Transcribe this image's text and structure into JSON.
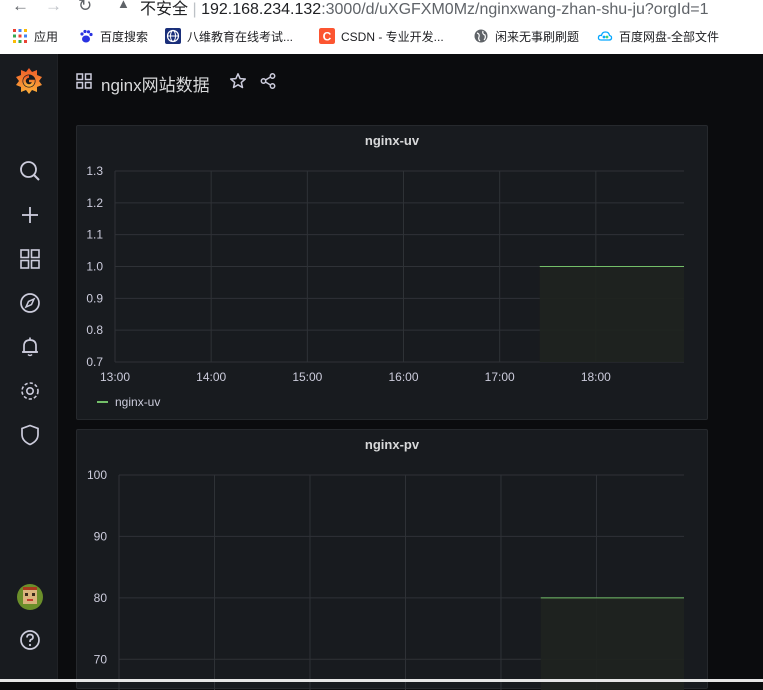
{
  "browser": {
    "security_label": "不安全",
    "url_host": "192.168.234.132",
    "url_path": ":3000/d/uXGFXM0Mz/nginxwang-zhan-shu-ju?orgId=1",
    "bookmarks": [
      {
        "label": "应用",
        "icon": "apps-grid-icon"
      },
      {
        "label": "百度搜索",
        "icon": "baidu-paw-icon"
      },
      {
        "label": "八维教育在线考试...",
        "icon": "bawei-globe-icon"
      },
      {
        "label": "CSDN - 专业开发...",
        "icon": "csdn-c-icon"
      },
      {
        "label": "闲来无事刷刷题",
        "icon": "globe-icon"
      },
      {
        "label": "百度网盘-全部文件",
        "icon": "baidu-cloud-icon"
      }
    ]
  },
  "dashboard": {
    "title": "nginx网站数据"
  },
  "sidebar": {
    "items": [
      "grafana-logo-icon",
      "search-icon",
      "plus-icon",
      "dashboards-grid-icon",
      "explore-compass-icon",
      "alerting-bell-icon",
      "configuration-gear-icon",
      "server-admin-shield-icon",
      "user-avatar",
      "help-icon"
    ]
  },
  "colors": {
    "series": "#73bf69",
    "panel_bg": "#181b1f",
    "page_bg": "#0b0c0e",
    "grid": "#2f3237",
    "fill": "#1f231f"
  },
  "chart_data": [
    {
      "type": "area",
      "title": "nginx-uv",
      "x_ticks": [
        "13:00",
        "14:00",
        "15:00",
        "16:00",
        "17:00",
        "18:00"
      ],
      "y_ticks": [
        "1.3",
        "1.2",
        "1.1",
        "1.0",
        "0.9",
        "0.8",
        "0.7"
      ],
      "ylim": [
        0.7,
        1.3
      ],
      "xlim": [
        "13:00",
        "18:55"
      ],
      "series": [
        {
          "name": "nginx-uv",
          "x": [
            "17:25",
            "18:55"
          ],
          "values": [
            1.0,
            1.0
          ]
        }
      ],
      "legend": "bottom-left",
      "grid": true
    },
    {
      "type": "area",
      "title": "nginx-pv",
      "y_ticks": [
        "100",
        "90",
        "80",
        "70"
      ],
      "ylim": [
        65,
        100
      ],
      "xlim": [
        "13:00",
        "18:55"
      ],
      "series": [
        {
          "x": [
            "17:25",
            "18:55"
          ],
          "values": [
            80,
            80
          ]
        }
      ],
      "grid": true
    }
  ]
}
